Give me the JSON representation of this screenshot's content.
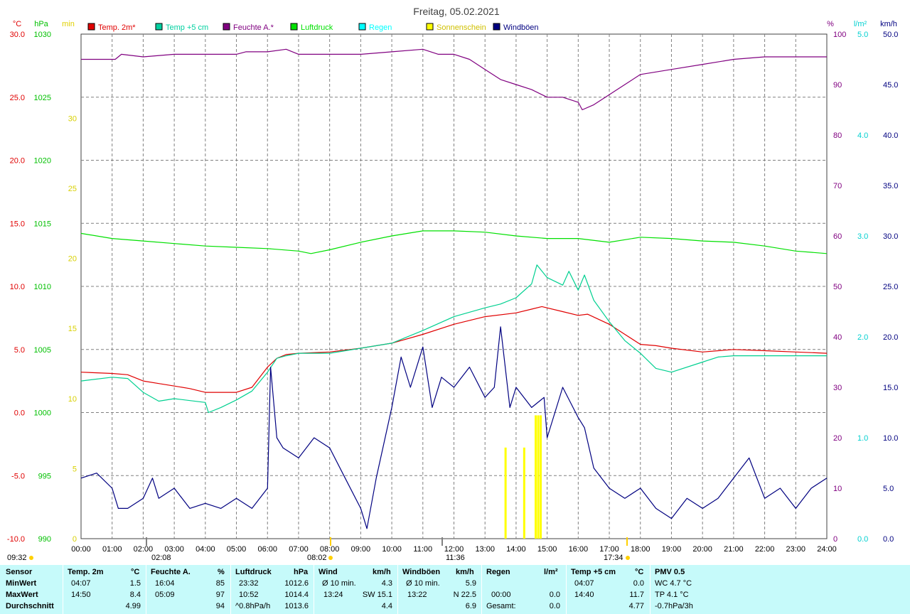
{
  "title": "Freitag, 05.02.2021",
  "colors": {
    "temp": "#e00000",
    "temp5": "#00c080",
    "humidity": "#800080",
    "pressure": "#00d000",
    "rain": "#00e0e0",
    "sun": "#ffff00",
    "gust": "#000080",
    "grid": "#808080"
  },
  "legend": [
    {
      "label": "Temp. 2m*",
      "color": "#e00000"
    },
    {
      "label": "Temp +5 cm",
      "color": "#00d0a0"
    },
    {
      "label": "Feuchte A.*",
      "color": "#800080"
    },
    {
      "label": "Luftdruck",
      "color": "#00e000"
    },
    {
      "label": "Regen",
      "color": "#00ffff"
    },
    {
      "label": "Sonnenschein",
      "color": "#ffff00"
    },
    {
      "label": "Windböen",
      "color": "#000080"
    }
  ],
  "axes": {
    "temp_unit": "°C",
    "pressure_unit": "hPa",
    "sun_unit": "min",
    "humidity_unit": "%",
    "rain_unit": "l/m²",
    "wind_unit": "km/h",
    "temp_ticks": [
      "30.0",
      "25.0",
      "20.0",
      "15.0",
      "10.0",
      "5.0",
      "0.0",
      "-5.0",
      "-10.0"
    ],
    "pressure_ticks": [
      "1030",
      "1025",
      "1020",
      "1015",
      "1010",
      "1005",
      "1000",
      "995",
      "990"
    ],
    "sun_ticks": [
      "30",
      "25",
      "20",
      "15",
      "10",
      "5",
      "0"
    ],
    "humidity_ticks": [
      "100",
      "90",
      "80",
      "70",
      "60",
      "50",
      "40",
      "30",
      "20",
      "10",
      "0"
    ],
    "rain_ticks": [
      "5.0",
      "4.0",
      "3.0",
      "2.0",
      "1.0",
      "0.0"
    ],
    "wind_ticks": [
      "50.0",
      "45.0",
      "40.0",
      "35.0",
      "30.0",
      "25.0",
      "20.0",
      "15.0",
      "10.0",
      "5.0",
      "0.0"
    ],
    "x_ticks": [
      "00:00",
      "01:00",
      "02:00",
      "03:00",
      "04:00",
      "05:00",
      "06:00",
      "07:00",
      "08:00",
      "09:00",
      "10:00",
      "11:00",
      "12:00",
      "13:00",
      "14:00",
      "15:00",
      "16:00",
      "17:00",
      "18:00",
      "19:00",
      "20:00",
      "21:00",
      "22:00",
      "23:00",
      "24:00"
    ]
  },
  "markers": {
    "sunshine_total": "09:32",
    "low_time": "02:08",
    "sunrise": "08:02",
    "solar_noon": "11:36",
    "sunset": "17:34"
  },
  "chart_data": {
    "type": "line",
    "x_unit": "hours",
    "x_range": [
      0,
      24
    ],
    "series": [
      {
        "name": "Temp. 2m*",
        "axis": "°C",
        "range": [
          -10,
          30
        ],
        "points": [
          [
            0,
            3.2
          ],
          [
            1,
            3.1
          ],
          [
            1.5,
            3.0
          ],
          [
            2,
            2.5
          ],
          [
            2.5,
            2.3
          ],
          [
            3,
            2.1
          ],
          [
            3.5,
            1.9
          ],
          [
            4,
            1.6
          ],
          [
            5,
            1.6
          ],
          [
            5.5,
            2.0
          ],
          [
            6,
            3.6
          ],
          [
            6.3,
            4.3
          ],
          [
            6.6,
            4.6
          ],
          [
            7,
            4.7
          ],
          [
            8,
            4.8
          ],
          [
            9,
            5.1
          ],
          [
            10,
            5.5
          ],
          [
            11,
            6.2
          ],
          [
            12,
            7.0
          ],
          [
            13,
            7.6
          ],
          [
            14,
            7.9
          ],
          [
            14.5,
            8.2
          ],
          [
            14.83,
            8.4
          ],
          [
            15.5,
            8.0
          ],
          [
            16,
            7.7
          ],
          [
            16.3,
            7.8
          ],
          [
            17,
            7.0
          ],
          [
            17.5,
            6.2
          ],
          [
            18,
            5.4
          ],
          [
            18.5,
            5.3
          ],
          [
            19,
            5.1
          ],
          [
            20,
            4.8
          ],
          [
            21,
            5.0
          ],
          [
            22,
            4.9
          ],
          [
            23,
            4.8
          ],
          [
            24,
            4.7
          ]
        ]
      },
      {
        "name": "Temp +5 cm",
        "axis": "°C",
        "range": [
          -10,
          30
        ],
        "points": [
          [
            0,
            2.5
          ],
          [
            1,
            2.8
          ],
          [
            1.5,
            2.7
          ],
          [
            2,
            1.6
          ],
          [
            2.5,
            0.9
          ],
          [
            3,
            1.1
          ],
          [
            4,
            0.8
          ],
          [
            4.1,
            0.0
          ],
          [
            4.5,
            0.4
          ],
          [
            5,
            1.0
          ],
          [
            5.5,
            1.7
          ],
          [
            6,
            3.2
          ],
          [
            6.3,
            4.3
          ],
          [
            6.6,
            4.5
          ],
          [
            7,
            4.7
          ],
          [
            8,
            4.7
          ],
          [
            9,
            5.1
          ],
          [
            10,
            5.5
          ],
          [
            11,
            6.5
          ],
          [
            12,
            7.6
          ],
          [
            13,
            8.3
          ],
          [
            13.5,
            8.6
          ],
          [
            14,
            9.1
          ],
          [
            14.5,
            10.2
          ],
          [
            14.67,
            11.7
          ],
          [
            15,
            10.7
          ],
          [
            15.5,
            10.1
          ],
          [
            15.7,
            11.2
          ],
          [
            16,
            9.7
          ],
          [
            16.2,
            10.9
          ],
          [
            16.5,
            8.9
          ],
          [
            17,
            7.2
          ],
          [
            17.5,
            5.7
          ],
          [
            18,
            4.7
          ],
          [
            18.5,
            3.5
          ],
          [
            19,
            3.2
          ],
          [
            20,
            4.0
          ],
          [
            20.5,
            4.4
          ],
          [
            21,
            4.5
          ],
          [
            22,
            4.5
          ],
          [
            23,
            4.5
          ],
          [
            24,
            4.5
          ]
        ]
      },
      {
        "name": "Feuchte A.*",
        "axis": "%",
        "range": [
          0,
          100
        ],
        "points": [
          [
            0,
            95
          ],
          [
            1.1,
            95
          ],
          [
            1.3,
            96
          ],
          [
            2,
            95.5
          ],
          [
            3,
            96
          ],
          [
            5,
            96
          ],
          [
            5.3,
            96.5
          ],
          [
            6,
            96.5
          ],
          [
            6.6,
            97
          ],
          [
            7,
            96
          ],
          [
            9,
            96
          ],
          [
            10,
            96.5
          ],
          [
            11,
            97
          ],
          [
            11.5,
            96
          ],
          [
            12,
            96
          ],
          [
            12.5,
            95
          ],
          [
            13,
            93
          ],
          [
            13.5,
            91
          ],
          [
            14,
            90
          ],
          [
            14.5,
            89
          ],
          [
            15,
            87.5
          ],
          [
            15.5,
            87.5
          ],
          [
            16,
            86.5
          ],
          [
            16.13,
            85
          ],
          [
            16.5,
            86
          ],
          [
            17,
            88
          ],
          [
            17.5,
            90
          ],
          [
            18,
            92
          ],
          [
            19,
            93
          ],
          [
            20,
            94
          ],
          [
            21,
            95
          ],
          [
            22,
            95.5
          ],
          [
            24,
            95.5
          ]
        ]
      },
      {
        "name": "Luftdruck",
        "axis": "hPa",
        "range": [
          990,
          1030
        ],
        "points": [
          [
            0,
            1014.2
          ],
          [
            1,
            1013.8
          ],
          [
            2,
            1013.6
          ],
          [
            3,
            1013.4
          ],
          [
            4,
            1013.2
          ],
          [
            5,
            1013.1
          ],
          [
            6,
            1013.0
          ],
          [
            7,
            1012.8
          ],
          [
            7.4,
            1012.6
          ],
          [
            8,
            1012.9
          ],
          [
            9,
            1013.5
          ],
          [
            10,
            1014.0
          ],
          [
            11,
            1014.4
          ],
          [
            12,
            1014.4
          ],
          [
            13,
            1014.3
          ],
          [
            14,
            1014.0
          ],
          [
            15,
            1013.8
          ],
          [
            16,
            1013.8
          ],
          [
            17,
            1013.5
          ],
          [
            18,
            1013.9
          ],
          [
            19,
            1013.8
          ],
          [
            20,
            1013.6
          ],
          [
            21,
            1013.5
          ],
          [
            22,
            1013.2
          ],
          [
            23,
            1012.8
          ],
          [
            24,
            1012.6
          ]
        ]
      },
      {
        "name": "Windböen",
        "axis": "km/h",
        "range": [
          0,
          50
        ],
        "points": [
          [
            0,
            6
          ],
          [
            0.5,
            6.5
          ],
          [
            1,
            5
          ],
          [
            1.2,
            3
          ],
          [
            1.5,
            3
          ],
          [
            2,
            4
          ],
          [
            2.3,
            6
          ],
          [
            2.5,
            4
          ],
          [
            3,
            5
          ],
          [
            3.5,
            3
          ],
          [
            4,
            3.5
          ],
          [
            4.5,
            3
          ],
          [
            5,
            4
          ],
          [
            5.5,
            3
          ],
          [
            6,
            5
          ],
          [
            6.1,
            17
          ],
          [
            6.3,
            10
          ],
          [
            6.5,
            9
          ],
          [
            7,
            8
          ],
          [
            7.5,
            10
          ],
          [
            8,
            9
          ],
          [
            8.5,
            6
          ],
          [
            9,
            3
          ],
          [
            9.2,
            1
          ],
          [
            9.5,
            6
          ],
          [
            10,
            13
          ],
          [
            10.3,
            18
          ],
          [
            10.6,
            15
          ],
          [
            11,
            19
          ],
          [
            11.3,
            13
          ],
          [
            11.6,
            16
          ],
          [
            12,
            15
          ],
          [
            12.5,
            17
          ],
          [
            13,
            14
          ],
          [
            13.3,
            15
          ],
          [
            13.5,
            21
          ],
          [
            13.8,
            13
          ],
          [
            14,
            15
          ],
          [
            14.5,
            13
          ],
          [
            14.9,
            14
          ],
          [
            15,
            10
          ],
          [
            15.5,
            15
          ],
          [
            16,
            12
          ],
          [
            16.2,
            11
          ],
          [
            16.5,
            7
          ],
          [
            17,
            5
          ],
          [
            17.5,
            4
          ],
          [
            18,
            5
          ],
          [
            18.5,
            3
          ],
          [
            19,
            2
          ],
          [
            19.5,
            4
          ],
          [
            20,
            3
          ],
          [
            20.5,
            4
          ],
          [
            21,
            6
          ],
          [
            21.5,
            8
          ],
          [
            22,
            4
          ],
          [
            22.5,
            5
          ],
          [
            23,
            3
          ],
          [
            23.5,
            5
          ],
          [
            24,
            6
          ]
        ]
      }
    ],
    "sunshine_bars": [
      [
        13.65,
        6.5
      ],
      [
        14.25,
        6.5
      ],
      [
        14.62,
        8.8
      ],
      [
        14.7,
        8.8
      ],
      [
        14.78,
        8.8
      ]
    ]
  },
  "stats": {
    "header": {
      "sensor": "Sensor",
      "temp": "Temp. 2m",
      "temp_u": "°C",
      "hum": "Feuchte A.",
      "hum_u": "%",
      "press": "Luftdruck",
      "press_u": "hPa",
      "wind": "Wind",
      "wind_u": "km/h",
      "gust": "Windböen",
      "gust_u": "km/h",
      "rain": "Regen",
      "rain_u": "l/m²",
      "temp5": "Temp +5 cm",
      "temp5_u": "°C",
      "pmv": "PMV 0.5"
    },
    "labels": {
      "min": "MinWert",
      "max": "MaxWert",
      "avg": "Durchschnitt"
    },
    "temp": {
      "min_t": "04:07",
      "min_v": "1.5",
      "max_t": "14:50",
      "max_v": "8.4",
      "avg": "4.99"
    },
    "hum": {
      "min_t": "16:04",
      "min_v": "85",
      "max_t": "05:09",
      "max_v": "97",
      "avg": "94"
    },
    "press": {
      "min_t": "23:32",
      "min_v": "1012.6",
      "max_t": "10:52",
      "max_v": "1014.4",
      "trend": "^0.8hPa/h",
      "avg": "1013.6"
    },
    "wind": {
      "min_l": "Ø 10 min.",
      "min_v": "4.3",
      "max_t": "13:24",
      "max_d": "SW 15.1",
      "avg": "4.4"
    },
    "gust": {
      "min_l": "Ø 10 min.",
      "min_v": "5.9",
      "max_t": "13:22",
      "max_d": "N 22.5",
      "avg": "6.9"
    },
    "rain": {
      "max_t": "00:00",
      "max_v": "0.0",
      "avg_l": "Gesamt:",
      "avg_v": "0.0"
    },
    "temp5": {
      "min_t": "04:07",
      "min_v": "0.0",
      "max_t": "14:40",
      "max_v": "11.7",
      "avg": "4.77"
    },
    "pmv": {
      "min": "WC 4.7 °C",
      "max": "TP 4.1 °C",
      "avg": "-0.7hPa/3h"
    }
  }
}
